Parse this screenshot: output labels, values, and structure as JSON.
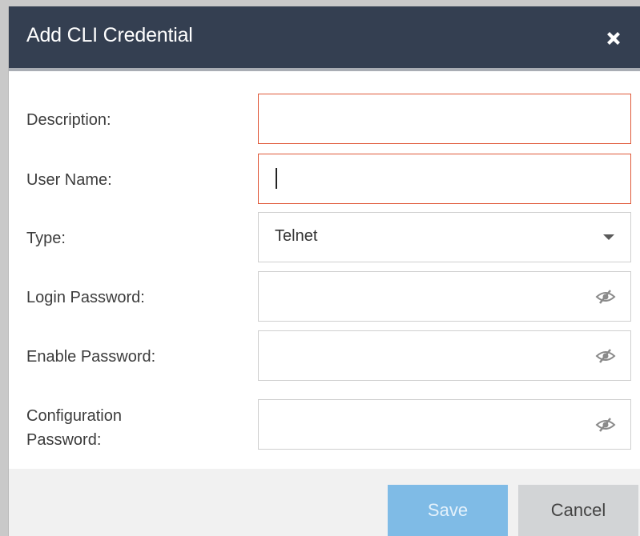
{
  "dialog": {
    "title": "Add CLI Credential",
    "close_icon": "close-icon"
  },
  "form": {
    "description_label": "Description:",
    "description_value": "",
    "username_label": "User Name:",
    "username_value": "",
    "type_label": "Type:",
    "type_value": "Telnet",
    "login_password_label": "Login Password:",
    "enable_password_label": "Enable Password:",
    "config_password_label_line1": "Configuration",
    "config_password_label_line2": "Password:",
    "password_toggle_icon": "eye-slash-icon"
  },
  "footer": {
    "save_label": "Save",
    "cancel_label": "Cancel"
  },
  "colors": {
    "titlebar": "#343f51",
    "error_border": "#e05a3a",
    "save_button": "#7fbbe6",
    "cancel_button": "#d2d4d6"
  }
}
